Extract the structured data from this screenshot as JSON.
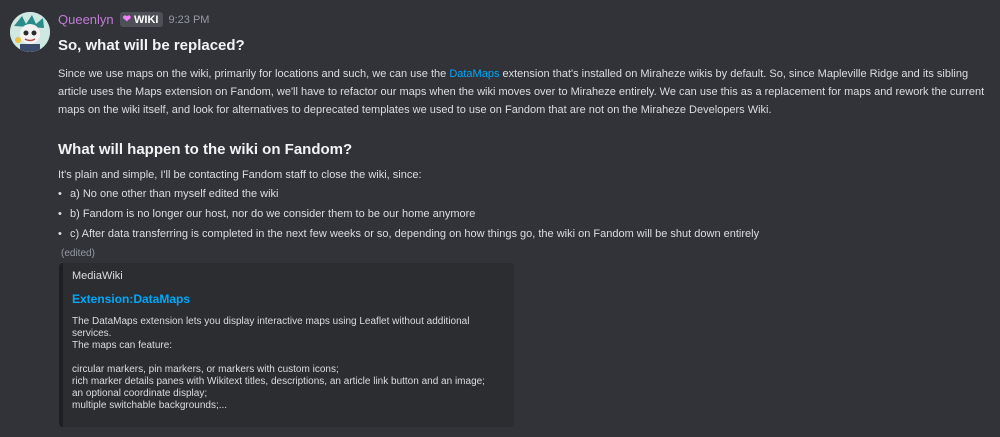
{
  "message": {
    "author": "Queenlyn",
    "tag_label": "WIKI",
    "tag_icon": "heart-icon",
    "timestamp": "9:23 PM",
    "heading1": "So, what will be replaced?",
    "para1_before": "Since we use maps on the wiki, primarily for locations and such, we can use the ",
    "para1_link": "DataMaps",
    "para1_after": " extension that's installed on Miraheze wikis by default. So, since Mapleville Ridge and its sibling article uses the Maps extension on Fandom, we'll have to refactor our maps when the wiki moves over to Miraheze entirely.  We can use this as a replacement for maps and rework the current maps on the wiki itself, and look for alternatives to deprecated templates we used to use on Fandom that are not on the Miraheze Developers Wiki.",
    "heading2": "What will happen to the wiki on Fandom?",
    "para2": "It's plain and simple, I'll be contacting Fandom staff to close the wiki, since:",
    "bullets": [
      "a) No one other than myself edited the wiki",
      "b) Fandom is no longer our host, nor do we consider them to be our home anymore",
      "c) After data transferring is completed in the next few weeks or so, depending on how things go, the wiki on Fandom will be shut down entirely"
    ],
    "edited": "(edited)"
  },
  "embed": {
    "provider": "MediaWiki",
    "title": "Extension:DataMaps",
    "desc_lines": [
      "The DataMaps extension lets you display interactive maps using Leaflet without additional",
      "services.",
      "The maps can feature:",
      "",
      "circular markers, pin markers, or markers with custom icons;",
      "rich marker details panes with Wikitext titles, descriptions, an article link button and an image;",
      "an optional coordinate display;",
      "multiple switchable backgrounds;..."
    ]
  },
  "colors": {
    "background": "#313338",
    "username": "#c27bd6",
    "link": "#00a8fc",
    "embed_bg": "#2b2d31"
  }
}
